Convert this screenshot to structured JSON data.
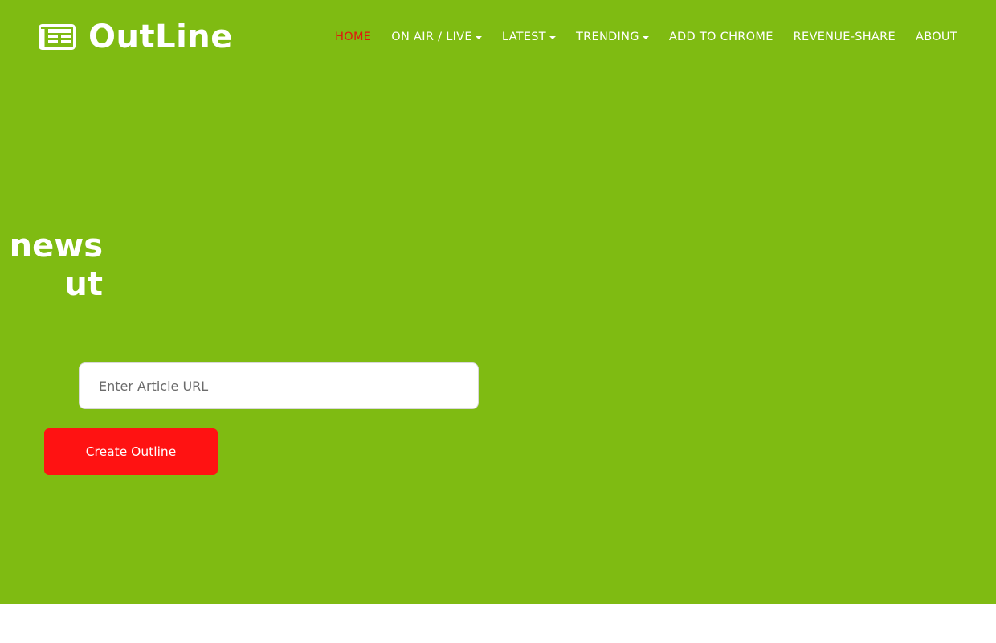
{
  "colors": {
    "hero_bg": "#7fbb12",
    "active_nav": "#e0190f",
    "primary_button": "#ff1212",
    "text_light": "#ffffff"
  },
  "brand": {
    "icon": "newspaper-icon",
    "name": "OutLine"
  },
  "nav": {
    "items": [
      {
        "label": "HOME",
        "active": true,
        "dropdown": false
      },
      {
        "label": "ON AIR / LIVE",
        "active": false,
        "dropdown": true
      },
      {
        "label": "LATEST",
        "active": false,
        "dropdown": true
      },
      {
        "label": "TRENDING",
        "active": false,
        "dropdown": true
      },
      {
        "label": "ADD TO CHROME",
        "active": false,
        "dropdown": false
      },
      {
        "label": "REVENUE-SHARE",
        "active": false,
        "dropdown": false
      },
      {
        "label": "ABOUT",
        "active": false,
        "dropdown": false
      }
    ]
  },
  "hero": {
    "headline_line1": "e news",
    "headline_line2": "ut"
  },
  "form": {
    "url_placeholder": "Enter Article URL",
    "url_value": "",
    "submit_label": "Create Outline"
  }
}
